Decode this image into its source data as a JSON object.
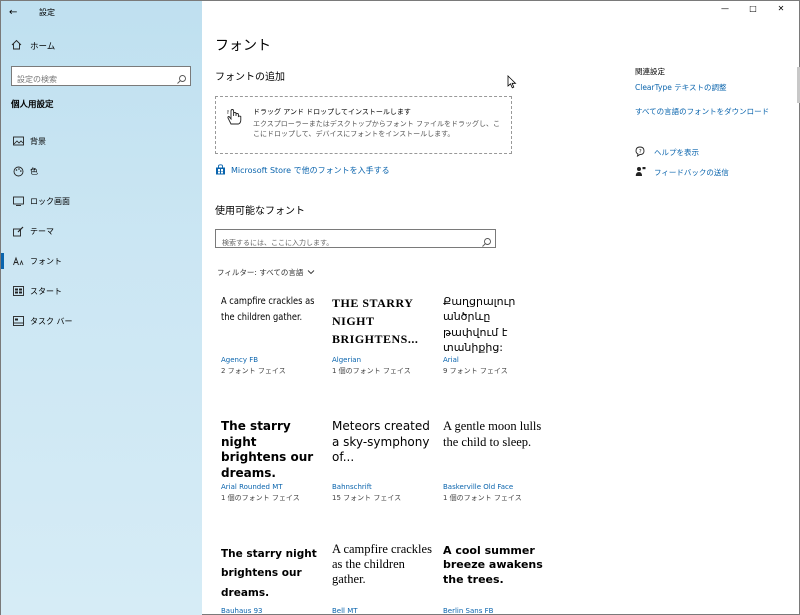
{
  "window": {
    "title": "設定",
    "back_glyph": "←",
    "controls": [
      "—",
      "□",
      "✕"
    ]
  },
  "sidebar": {
    "home_label": "ホーム",
    "search_placeholder": "設定の検索",
    "section_title": "個人用設定",
    "items": [
      {
        "label": "背景",
        "icon": "picture-icon"
      },
      {
        "label": "色",
        "icon": "palette-icon"
      },
      {
        "label": "ロック画面",
        "icon": "lock-screen-icon"
      },
      {
        "label": "テーマ",
        "icon": "theme-icon"
      },
      {
        "label": "フォント",
        "icon": "font-icon",
        "active": true
      },
      {
        "label": "スタート",
        "icon": "start-icon"
      },
      {
        "label": "タスク バー",
        "icon": "taskbar-icon"
      }
    ]
  },
  "main": {
    "page_title": "フォント",
    "add_title": "フォントの追加",
    "drop_title": "ドラッグ アンド ドロップしてインストールします",
    "drop_desc": "エクスプローラーまたはデスクトップからフォント ファイルをドラッグし、ここにドロップして、デバイスにフォントをインストールします。",
    "store_link": "Microsoft Store で他のフォントを入手する",
    "available_title": "使用可能なフォント",
    "font_search_placeholder": "検索するには、ここに入力します。",
    "filter_label": "フィルター: すべての言語"
  },
  "fonts": [
    {
      "sample": "A campfire crackles as the children gather.",
      "name": "Agency FB",
      "faces": "2 フォント フェイス"
    },
    {
      "sample": "THE STARRY NIGHT BRIGHTENS...",
      "name": "Algerian",
      "faces": "1 個のフォント フェイス"
    },
    {
      "sample": "Քաղցրալուր անծրևը թափվում է տանիքից:",
      "name": "Arial",
      "faces": "9 フォント フェイス"
    },
    {
      "sample": "The starry night brightens our dreams.",
      "name": "Arial Rounded MT",
      "faces": "1 個のフォント フェイス"
    },
    {
      "sample": "Meteors created a sky-symphony of...",
      "name": "Bahnschrift",
      "faces": "15 フォント フェイス"
    },
    {
      "sample": "A gentle moon lulls the child to sleep.",
      "name": "Baskerville Old Face",
      "faces": "1 個のフォント フェイス"
    },
    {
      "sample": "The starry night brightens our dreams.",
      "name": "Bauhaus 93",
      "faces": ""
    },
    {
      "sample": "A campfire crackles as the children gather.",
      "name": "Bell MT",
      "faces": ""
    },
    {
      "sample": "A cool summer breeze awakens the trees.",
      "name": "Berlin Sans FB",
      "faces": ""
    }
  ],
  "related": {
    "heading": "関連設定",
    "links": [
      "ClearType テキストの調整",
      "すべての言語のフォントをダウンロード"
    ],
    "help": "ヘルプを表示",
    "feedback": "フィードバックの送信"
  }
}
